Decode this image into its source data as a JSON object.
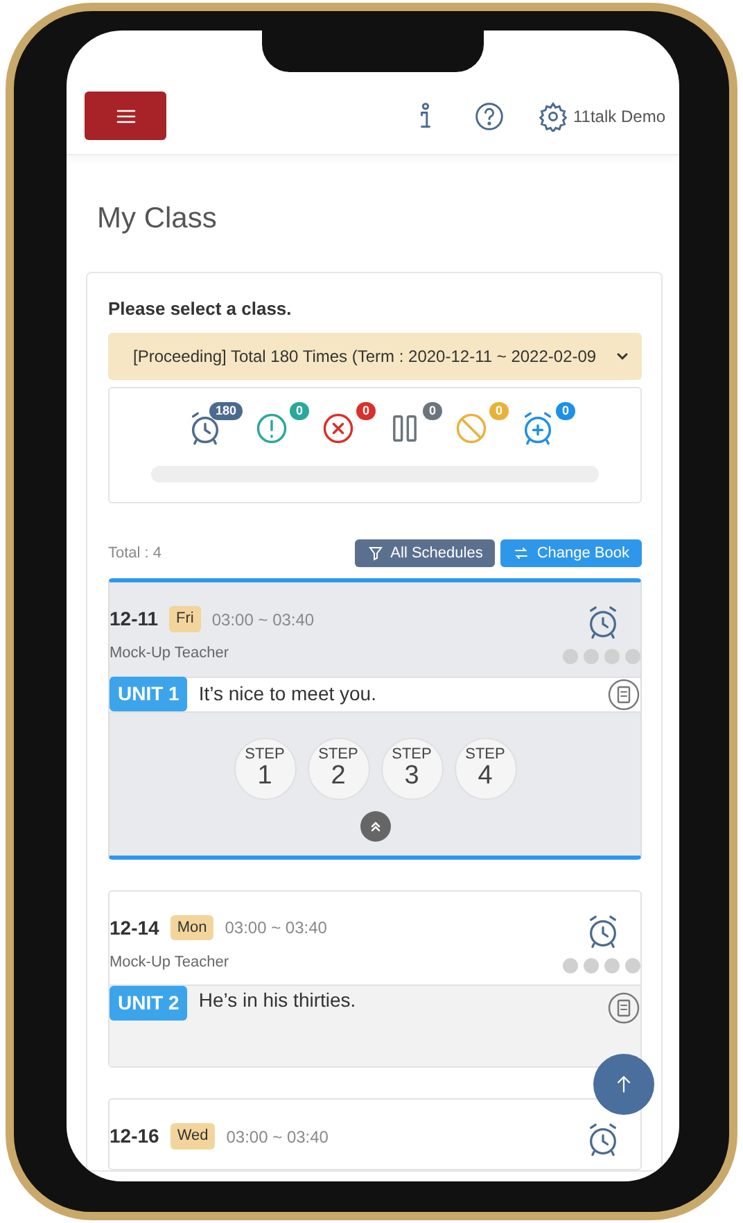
{
  "header": {
    "user": "11talk Demo"
  },
  "page_title": "My Class",
  "class_select": {
    "label": "Please select a class.",
    "value": "[Proceeding] Total 180 Times (Term : 2020-12-11 ~ 2022-02-09"
  },
  "stats": [
    {
      "kind": "alarm",
      "count": "180",
      "color": "#4b6a8f"
    },
    {
      "kind": "alert",
      "count": "0",
      "color": "#2aa89a"
    },
    {
      "kind": "cancel",
      "count": "0",
      "color": "#d9302c"
    },
    {
      "kind": "pause",
      "count": "0",
      "color": "#6c757d"
    },
    {
      "kind": "ban",
      "count": "0",
      "color": "#e8b23a"
    },
    {
      "kind": "add",
      "count": "0",
      "color": "#1e90e6"
    }
  ],
  "progress": {
    "level": 0
  },
  "total": "Total : 4",
  "buttons": [
    "All Schedules",
    "Change Book"
  ],
  "lessons": [
    {
      "date": "12-11",
      "day": "Fri",
      "time": "03:00 ~ 03:40",
      "teacher": "Mock-Up Teacher",
      "dots": [
        false,
        false,
        false,
        false
      ],
      "unit": "UNIT 1",
      "sentence": "It’s nice to meet you.",
      "expanded": true,
      "steps": [
        {
          "label": "STEP",
          "number": "1"
        },
        {
          "label": "STEP",
          "number": "2"
        },
        {
          "label": "STEP",
          "number": "3"
        },
        {
          "label": "STEP",
          "number": "4"
        }
      ]
    },
    {
      "date": "12-14",
      "day": "Mon",
      "time": "03:00 ~ 03:40",
      "teacher": "Mock-Up Teacher",
      "dots": [
        false,
        false,
        false,
        false
      ],
      "unit": "UNIT 2",
      "sentence": "He’s in his thirties.",
      "expanded": false
    },
    {
      "date": "12-16",
      "day": "Wed",
      "time": "03:00 ~ 03:40"
    }
  ]
}
